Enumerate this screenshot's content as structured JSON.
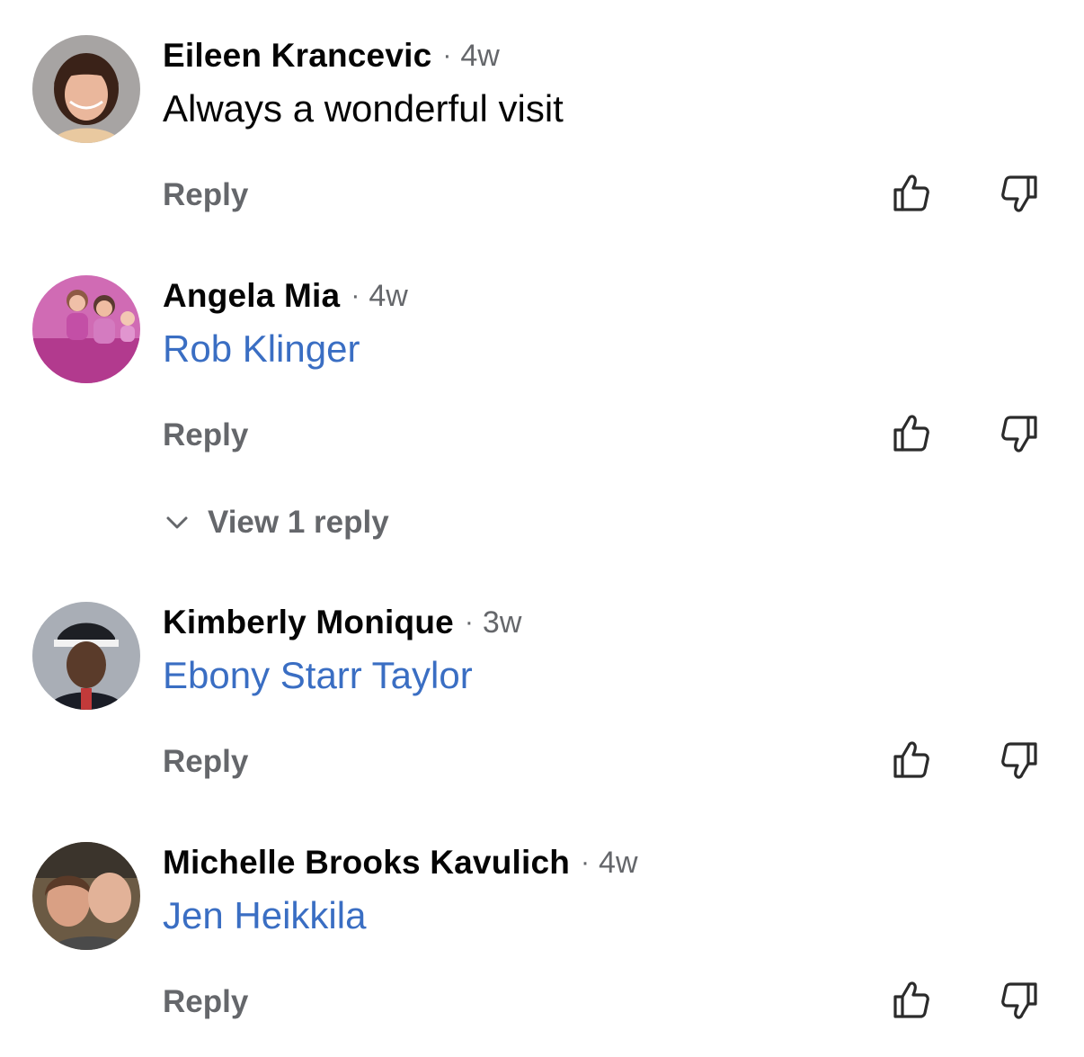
{
  "comments": [
    {
      "author": "Eileen Krancevic",
      "separator": "·",
      "time": "4w",
      "text": "Always a wonderful visit",
      "text_is_mention": false,
      "reply_label": "Reply",
      "like_icon": "thumbs-up-icon",
      "dislike_icon": "thumbs-down-icon"
    },
    {
      "author": "Angela Mia",
      "separator": "·",
      "time": "4w",
      "text": "Rob Klinger",
      "text_is_mention": true,
      "reply_label": "Reply",
      "like_icon": "thumbs-up-icon",
      "dislike_icon": "thumbs-down-icon",
      "view_replies_label": "View 1 reply"
    },
    {
      "author": "Kimberly Monique",
      "separator": "·",
      "time": "3w",
      "text": "Ebony Starr Taylor",
      "text_is_mention": true,
      "reply_label": "Reply",
      "like_icon": "thumbs-up-icon",
      "dislike_icon": "thumbs-down-icon"
    },
    {
      "author": "Michelle Brooks Kavulich",
      "separator": "·",
      "time": "4w",
      "text": "Jen Heikkila",
      "text_is_mention": true,
      "reply_label": "Reply",
      "like_icon": "thumbs-up-icon",
      "dislike_icon": "thumbs-down-icon"
    }
  ],
  "colors": {
    "author": "#050505",
    "meta": "#65676b",
    "mention": "#3a6ec3",
    "icon": "#2b2b2b"
  }
}
